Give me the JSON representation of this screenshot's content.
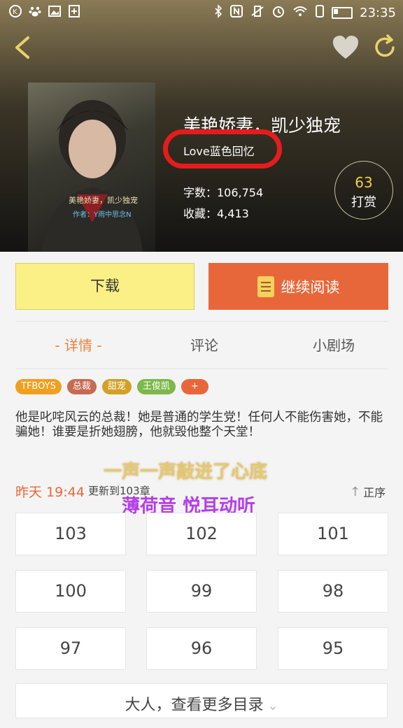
{
  "status_bar": {
    "time": "23:35"
  },
  "book": {
    "title": "美艳娇妻，凯少独宠",
    "author": "Love蓝色回忆",
    "word_count": "字数：106,754",
    "favorites": "收藏：4,413",
    "cover_title": "美艳娇妻，凯少独宠",
    "cover_author": "作者：Y雨中思念N"
  },
  "tip": {
    "count": "63",
    "label": "打赏"
  },
  "actions": {
    "download": "下载",
    "continue": "继续阅读"
  },
  "tabs": [
    {
      "label": "- 详情 -"
    },
    {
      "label": "评论"
    },
    {
      "label": "小剧场"
    }
  ],
  "tags": [
    {
      "label": "TFBOYS",
      "color": "#f0a020"
    },
    {
      "label": "总裁",
      "color": "#c76a54"
    },
    {
      "label": "甜宠",
      "color": "#d0a126"
    },
    {
      "label": "王俊凯",
      "color": "#7db84a"
    },
    {
      "label": "+",
      "color": "#e8673a"
    }
  ],
  "intro": "他是叱咤风云的总裁！她是普通的学生党！任何人不能伤害她，不能骗她！谁要是折她翅膀，他就毁他整个天堂！",
  "overlay": {
    "line1": "一声一声敲进了心底",
    "line2": "薄荷音 悦耳动听"
  },
  "update": {
    "time": "昨天 19:44",
    "text": "更新到103章",
    "sort": "正序"
  },
  "chapters": [
    "103",
    "102",
    "101",
    "100",
    "99",
    "98",
    "97",
    "96",
    "95"
  ],
  "more": "大人，查看更多目录",
  "colors": {
    "accent": "#e8673a",
    "download_bg": "#fbf085",
    "highlight_ring": "#e61c1c"
  }
}
